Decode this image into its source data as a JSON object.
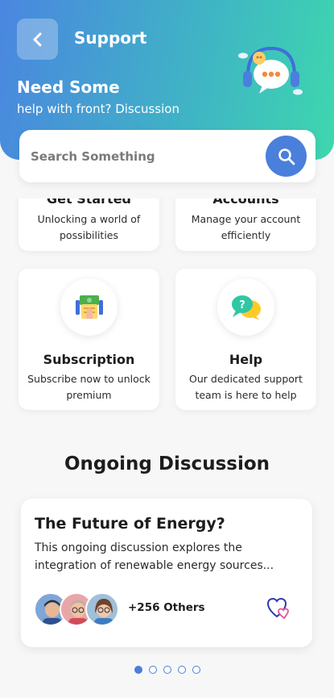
{
  "header": {
    "title": "Support",
    "hero_title": "Need Some",
    "hero_subtitle": "help with front? Discussion"
  },
  "search": {
    "placeholder": "Search Something"
  },
  "cards": [
    {
      "title": "Get Started",
      "description": "Unlocking a world of possibilities"
    },
    {
      "title": "Accounts",
      "description": "Manage your account efficiently"
    },
    {
      "title": "Subscription",
      "description": "Subscribe now to unlock premium",
      "icon": "money-calculator-icon"
    },
    {
      "title": "Help",
      "description": "Our dedicated support team is here to help",
      "icon": "chat-help-icon"
    }
  ],
  "discussion_section": {
    "title": "Ongoing Discussion",
    "card": {
      "title": "The Future of Energy?",
      "description": "This ongoing discussion explores the integration of renewable energy sources...",
      "participants_label": "+256 Others"
    }
  },
  "pagination": {
    "total": 5,
    "active_index": 0
  },
  "colors": {
    "accent": "#4a7fdc",
    "gradient_start": "#4a86e0",
    "gradient_end": "#3ed7ae"
  }
}
